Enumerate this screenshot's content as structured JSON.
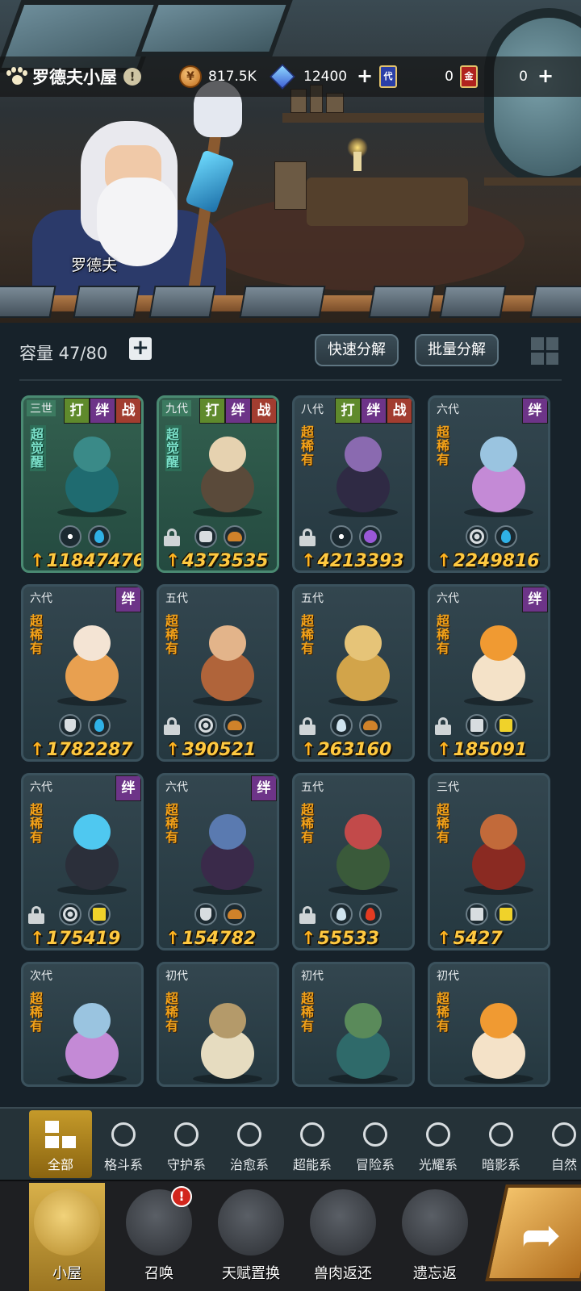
{
  "header": {
    "title": "罗德夫小屋",
    "npc_name": "罗德夫",
    "resources": {
      "coin": "817.5K",
      "gem": "12400",
      "card_blue": "0",
      "card_blue_glyph": "代",
      "card_red": "0",
      "card_red_glyph": "金"
    }
  },
  "toolbar": {
    "capacity": "容量 47/80",
    "quick_decompose": "快速分解",
    "batch_decompose": "批量分解"
  },
  "tag_labels": {
    "fight": "打",
    "bond": "绊",
    "war": "战"
  },
  "cards": [
    {
      "gen": "三世",
      "rarity": "超觉醒",
      "awaken": true,
      "tags": [
        "fight",
        "bond",
        "war"
      ],
      "locked": false,
      "attrs": [
        "eye",
        "water"
      ],
      "power": "11847476"
    },
    {
      "gen": "九代",
      "rarity": "超觉醒",
      "awaken": true,
      "tags": [
        "fight",
        "bond",
        "war"
      ],
      "locked": true,
      "attrs": [
        "fist",
        "fire-earth"
      ],
      "power": "4373535"
    },
    {
      "gen": "八代",
      "rarity": "超稀有",
      "awaken": false,
      "tags": [
        "fight",
        "bond",
        "war"
      ],
      "locked": true,
      "attrs": [
        "eye",
        "moon"
      ],
      "power": "4213393"
    },
    {
      "gen": "六代",
      "rarity": "超稀有",
      "awaken": false,
      "tags": [
        "bond"
      ],
      "locked": false,
      "attrs": [
        "target",
        "water"
      ],
      "power": "2249816"
    },
    {
      "gen": "六代",
      "rarity": "超稀有",
      "awaken": false,
      "tags": [
        "bond"
      ],
      "locked": false,
      "attrs": [
        "shield",
        "water"
      ],
      "power": "1782287"
    },
    {
      "gen": "五代",
      "rarity": "超稀有",
      "awaken": false,
      "tags": [],
      "locked": true,
      "attrs": [
        "target",
        "fire-earth"
      ],
      "power": "390521"
    },
    {
      "gen": "五代",
      "rarity": "超稀有",
      "awaken": false,
      "tags": [],
      "locked": true,
      "attrs": [
        "leaf",
        "fire-earth"
      ],
      "power": "263160"
    },
    {
      "gen": "六代",
      "rarity": "超稀有",
      "awaken": false,
      "tags": [
        "bond"
      ],
      "locked": true,
      "attrs": [
        "cross",
        "star"
      ],
      "power": "185091"
    },
    {
      "gen": "六代",
      "rarity": "超稀有",
      "awaken": false,
      "tags": [
        "bond"
      ],
      "locked": true,
      "attrs": [
        "target",
        "star"
      ],
      "power": "175419"
    },
    {
      "gen": "六代",
      "rarity": "超稀有",
      "awaken": false,
      "tags": [
        "bond"
      ],
      "locked": false,
      "attrs": [
        "shield",
        "fire-earth"
      ],
      "power": "154782"
    },
    {
      "gen": "五代",
      "rarity": "超稀有",
      "awaken": false,
      "tags": [],
      "locked": true,
      "attrs": [
        "leaf",
        "fire"
      ],
      "power": "55533"
    },
    {
      "gen": "三代",
      "rarity": "超稀有",
      "awaken": false,
      "tags": [],
      "locked": false,
      "attrs": [
        "cross",
        "star"
      ],
      "power": "5427"
    },
    {
      "gen": "次代",
      "rarity": "超稀有",
      "awaken": false,
      "tags": [],
      "locked": false,
      "attrs": [],
      "power": ""
    },
    {
      "gen": "初代",
      "rarity": "超稀有",
      "awaken": false,
      "tags": [],
      "locked": false,
      "attrs": [],
      "power": ""
    },
    {
      "gen": "初代",
      "rarity": "超稀有",
      "awaken": false,
      "tags": [],
      "locked": false,
      "attrs": [],
      "power": ""
    },
    {
      "gen": "初代",
      "rarity": "超稀有",
      "awaken": false,
      "tags": [],
      "locked": false,
      "attrs": [],
      "power": ""
    }
  ],
  "categories": [
    {
      "label": "全部",
      "icon": "all-icon",
      "active": true
    },
    {
      "label": "格斗系",
      "icon": "fist-icon"
    },
    {
      "label": "守护系",
      "icon": "shield-icon"
    },
    {
      "label": "治愈系",
      "icon": "sprout-icon"
    },
    {
      "label": "超能系",
      "icon": "psychic-icon"
    },
    {
      "label": "冒险系",
      "icon": "lantern-icon"
    },
    {
      "label": "光耀系",
      "icon": "light-icon"
    },
    {
      "label": "暗影系",
      "icon": "shadow-icon"
    },
    {
      "label": "自然",
      "icon": "nature-icon"
    }
  ],
  "nav": [
    {
      "label": "小屋",
      "icon": "house-icon",
      "active": true
    },
    {
      "label": "召唤",
      "icon": "egg-icon",
      "alert": "!"
    },
    {
      "label": "天赋置换",
      "icon": "swap-icon"
    },
    {
      "label": "兽肉返还",
      "icon": "meat-icon"
    },
    {
      "label": "遗忘返",
      "icon": "flame-icon"
    }
  ],
  "colors": {
    "rarity": "#f2a21a",
    "power": "#ffc940",
    "awaken_card": "#33604f",
    "active_tab": "#c59a2a"
  }
}
